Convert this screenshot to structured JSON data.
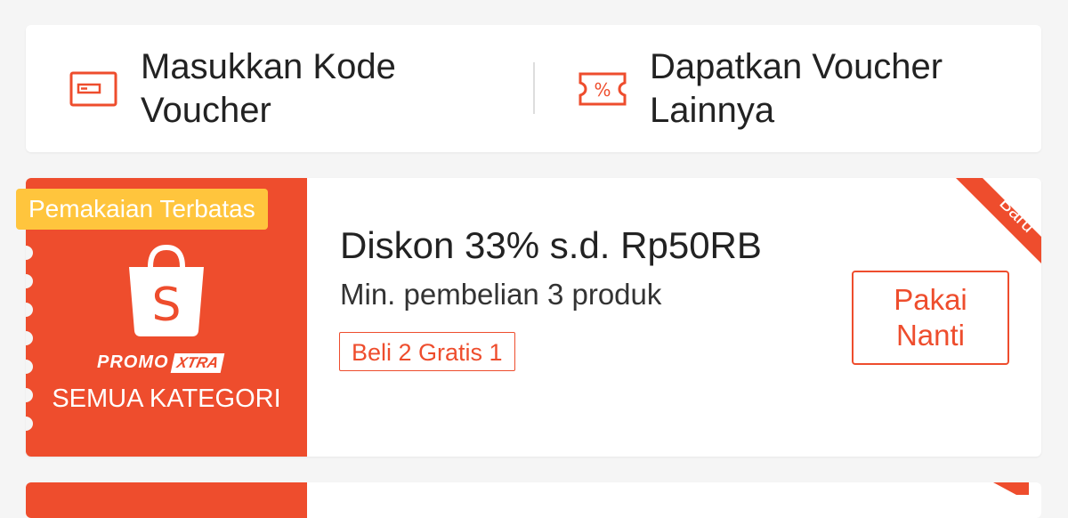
{
  "top_actions": {
    "enter_code": {
      "label_line1": "Masukkan Kode",
      "label_line2": "Voucher",
      "icon": "voucher-code-icon"
    },
    "more_vouchers": {
      "label_line1": "Dapatkan Voucher",
      "label_line2": "Lainnya",
      "icon": "discount-ticket-icon"
    }
  },
  "voucher": {
    "badge": "Pemakaian Terbatas",
    "brand_promo": "PROMO",
    "brand_xtra": "XTRA",
    "category": "SEMUA KATEGORI",
    "title": "Diskon 33% s.d. Rp50RB",
    "subtitle": "Min. pembelian 3 produk",
    "tag": "Beli 2 Gratis 1",
    "button_line1": "Pakai",
    "button_line2": "Nanti",
    "ribbon": "Baru"
  },
  "colors": {
    "accent": "#ee4d2d",
    "badge": "#ffc53d",
    "background": "#f5f5f5"
  }
}
